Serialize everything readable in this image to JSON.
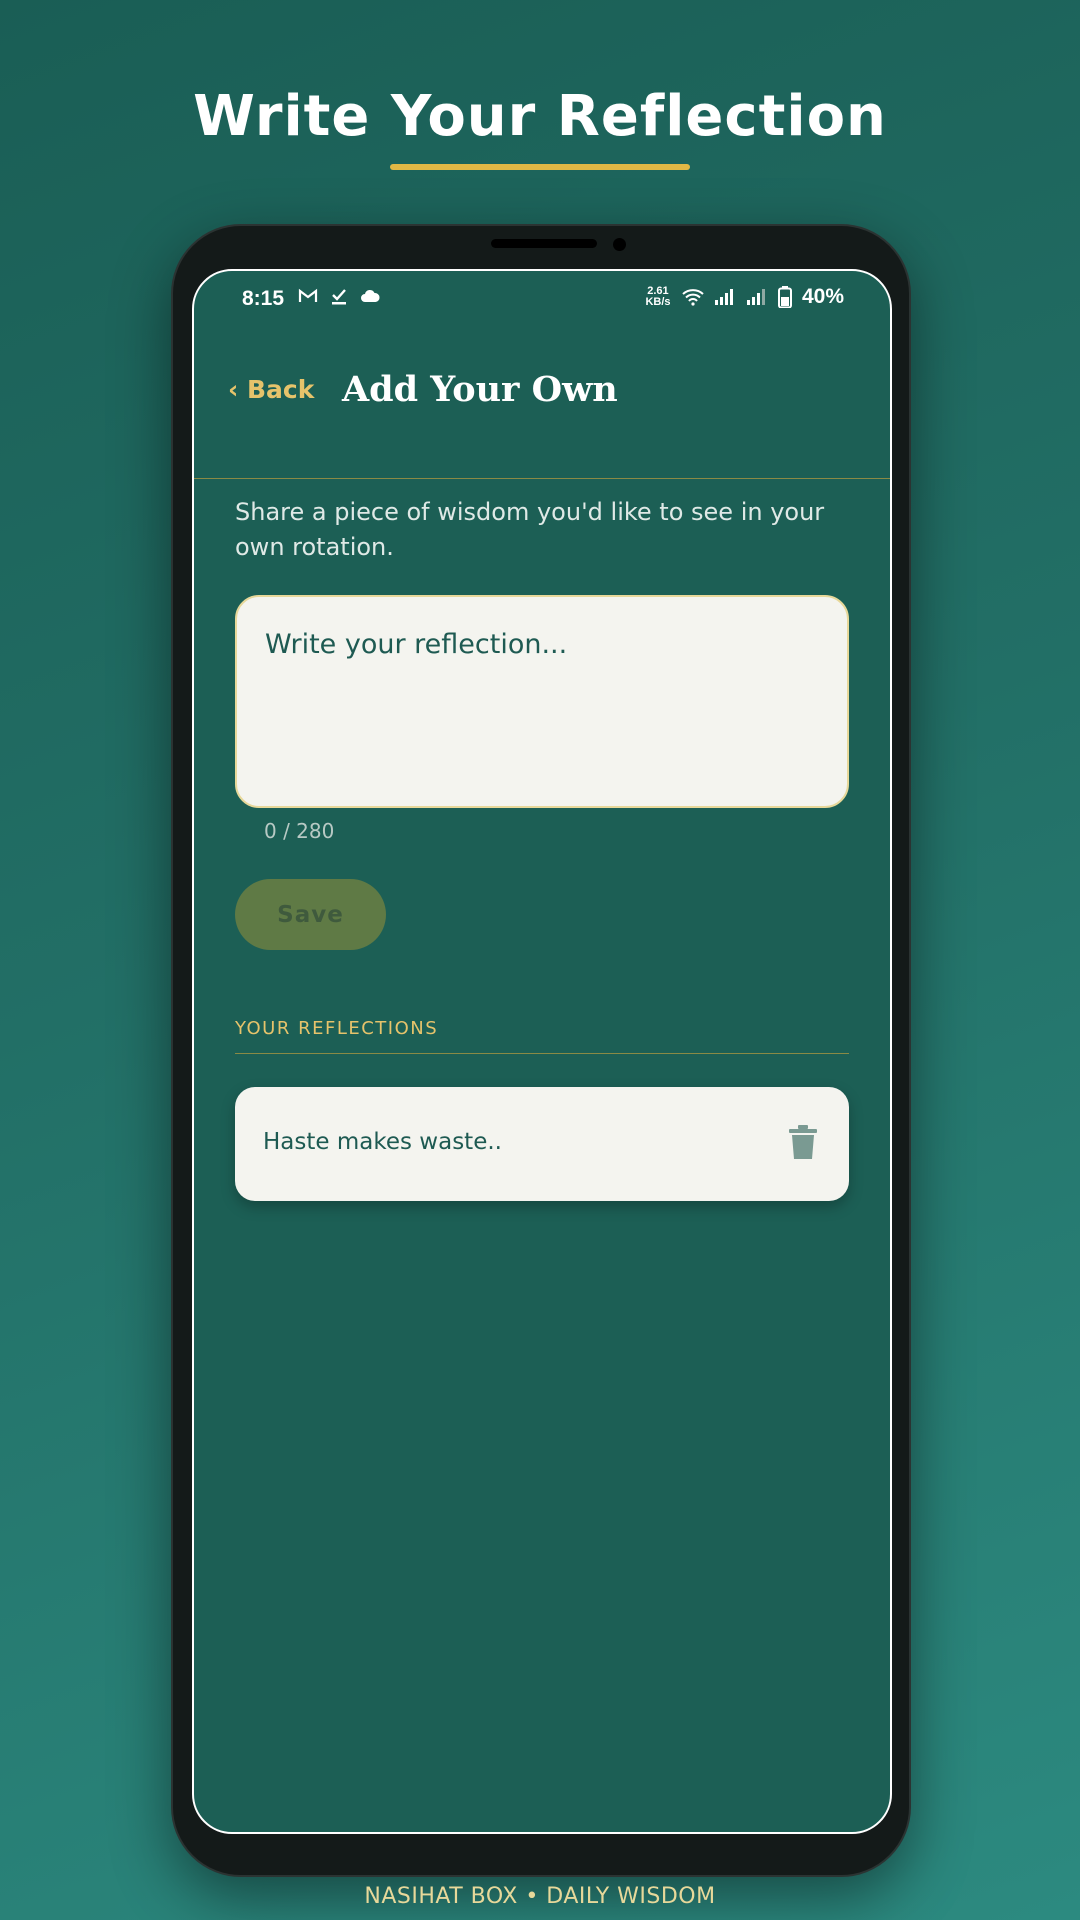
{
  "page": {
    "headline": "Write Your Reflection",
    "footer": "NASIHAT BOX  •  DAILY WISDOM"
  },
  "status_bar": {
    "time": "8:15",
    "left_icons": [
      "gmail-icon",
      "checkmark-icon",
      "cloud-icon"
    ],
    "speed_value": "2.61",
    "speed_unit": "KB/s",
    "right_icons": [
      "wifi-icon",
      "signal-icon",
      "signal-icon",
      "battery-icon"
    ],
    "battery": "40%"
  },
  "app_bar": {
    "back_label": "‹ Back",
    "title": "Add Your Own"
  },
  "form": {
    "intro": "Share a piece of wisdom you'd like to see in your own rotation.",
    "input_placeholder": "Write your reflection...",
    "input_value": "",
    "char_count": "0 / 280",
    "save_label": "Save"
  },
  "reflections": {
    "section_label": "YOUR REFLECTIONS",
    "items": [
      {
        "text": "Haste makes waste..",
        "action_icon": "trash-icon"
      }
    ]
  },
  "colors": {
    "background": "#1f6a60",
    "screen": "#1c5f55",
    "accent_gold": "#e6c36b",
    "card": "#f4f4ef",
    "save_disabled": "#5f7a45"
  }
}
